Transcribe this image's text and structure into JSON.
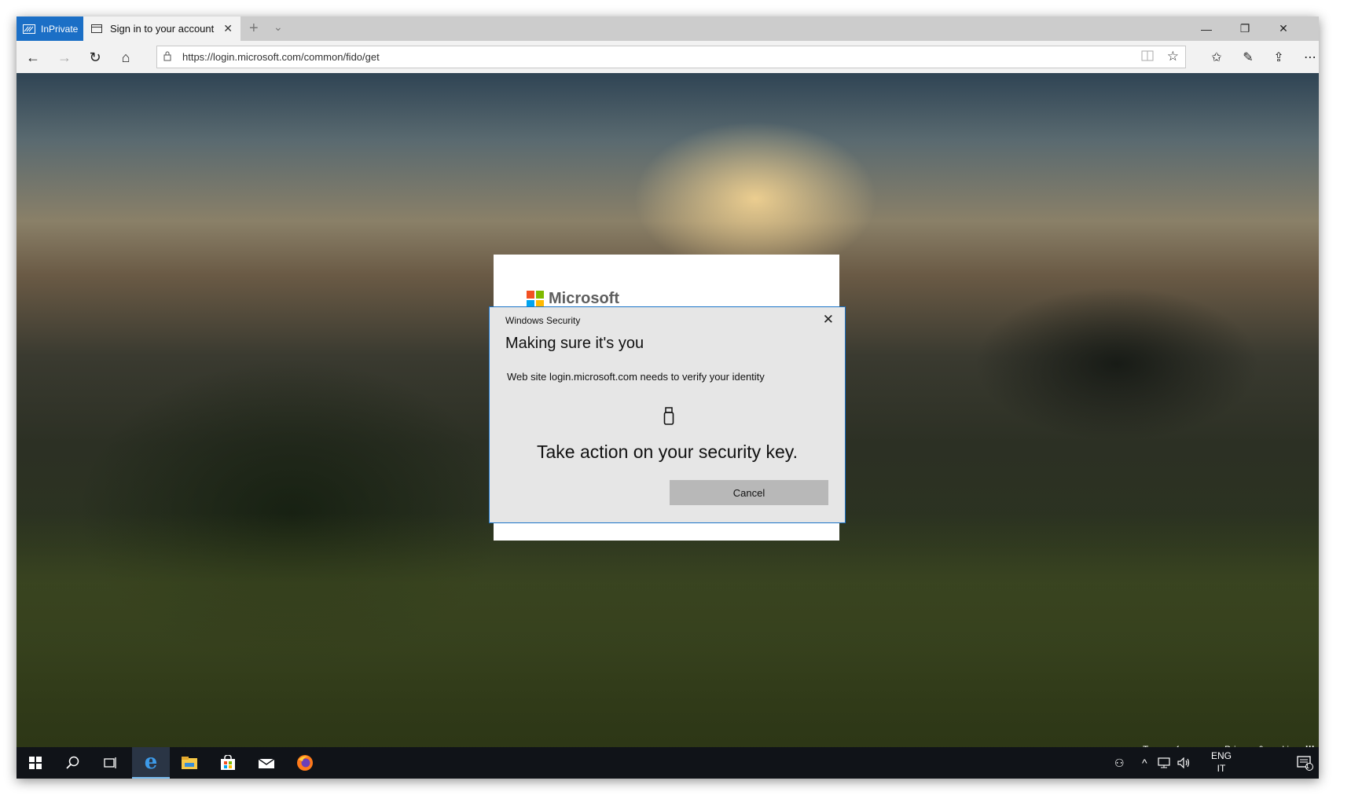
{
  "browser": {
    "inprivate_label": "InPrivate",
    "tab_title": "Sign in to your account",
    "tab_close": "✕",
    "new_tab": "+",
    "tab_menu": "⌄",
    "window_controls": {
      "minimize": "—",
      "restore": "❐",
      "close": "✕"
    },
    "nav": {
      "back": "←",
      "forward": "→",
      "refresh": "↻",
      "home": "⌂"
    },
    "url": "https://login.microsoft.com/common/fido/get",
    "toolbar": {
      "favorites": "✩",
      "pen": "✎",
      "share": "⇪",
      "more": "⋯"
    }
  },
  "page": {
    "brand": "Microsoft",
    "logo_colors": [
      "#f25022",
      "#7fba00",
      "#00a4ef",
      "#ffb900"
    ],
    "footer": {
      "terms": "Terms of use",
      "privacy": "Privacy & cookies",
      "more": "···"
    }
  },
  "dialog": {
    "caption": "Windows Security",
    "title": "Making sure it's you",
    "message": "Web site login.microsoft.com needs to verify your identity",
    "action": "Take action on your security key.",
    "cancel_label": "Cancel",
    "close": "✕",
    "border_color": "#1a73c8"
  },
  "taskbar": {
    "icons": [
      "windows-start-icon",
      "search-icon",
      "task-view-icon",
      "edge-icon",
      "file-explorer-icon",
      "store-icon",
      "mail-icon",
      "firefox-icon"
    ],
    "tray": {
      "people": "⚇",
      "chevron": "^",
      "network": "🖧",
      "volume": "🔊"
    },
    "language": "ENG",
    "region": "IT",
    "notification_count": "1"
  }
}
